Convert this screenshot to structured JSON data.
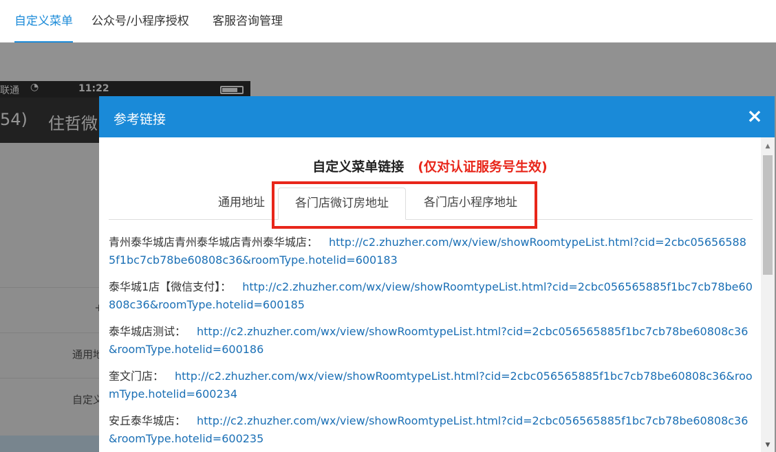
{
  "top_tabs": [
    {
      "label": "自定义菜单",
      "active": true
    },
    {
      "label": "公众号/小程序授权",
      "active": false
    },
    {
      "label": "客服咨询管理",
      "active": false
    }
  ],
  "background": {
    "carrier": "联通",
    "time": "11:22",
    "count_fragment": "54)",
    "account_fragment": "住哲微",
    "plus": "+",
    "row_general": "通用地",
    "row_custom": "自定义"
  },
  "modal": {
    "title": "参考链接",
    "close_icon": "×",
    "heading": "自定义菜单链接",
    "heading_note": "(仅对认证服务号生效)",
    "tabs": [
      {
        "label": "通用地址",
        "active": false
      },
      {
        "label": "各门店微订房地址",
        "active": true
      },
      {
        "label": "各门店小程序地址",
        "active": false
      }
    ],
    "links": [
      {
        "store": "青州泰华城店青州泰华城店青州泰华城店：",
        "url": "http://c2.zhuzher.com/wx/view/showRoomtypeList.html?cid=2cbc056565885f1bc7cb78be60808c36&roomType.hotelid=600183"
      },
      {
        "store": "泰华城1店【微信支付】：",
        "url": "http://c2.zhuzher.com/wx/view/showRoomtypeList.html?cid=2cbc056565885f1bc7cb78be60808c36&roomType.hotelid=600185"
      },
      {
        "store": "泰华城店测试：",
        "url": "http://c2.zhuzher.com/wx/view/showRoomtypeList.html?cid=2cbc056565885f1bc7cb78be60808c36&roomType.hotelid=600186"
      },
      {
        "store": "奎文门店：",
        "url": "http://c2.zhuzher.com/wx/view/showRoomtypeList.html?cid=2cbc056565885f1bc7cb78be60808c36&roomType.hotelid=600234"
      },
      {
        "store": "安丘泰华城店：",
        "url": "http://c2.zhuzher.com/wx/view/showRoomtypeList.html?cid=2cbc056565885f1bc7cb78be60808c36&roomType.hotelid=600235"
      }
    ]
  },
  "colors": {
    "accent": "#1a8ad8",
    "highlight": "#e8261a",
    "link": "#1a6fb5"
  }
}
